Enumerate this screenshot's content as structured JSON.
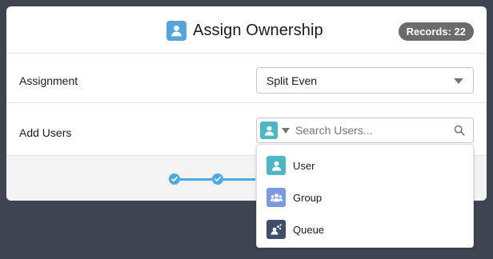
{
  "header": {
    "title": "Assign Ownership",
    "title_icon": "user-icon",
    "badge": "Records: 22"
  },
  "assignment": {
    "label": "Assignment",
    "value": "Split Even"
  },
  "add_users": {
    "label": "Add Users",
    "placeholder": "Search Users...",
    "entity_icon": "user-icon"
  },
  "dropdown": {
    "items": [
      {
        "label": "User",
        "icon": "user-icon",
        "color": "#4fb7c3"
      },
      {
        "label": "Group",
        "icon": "group-icon",
        "color": "#7a9ae3"
      },
      {
        "label": "Queue",
        "icon": "queue-icon",
        "color": "#3d4d6b"
      }
    ]
  },
  "progress": {
    "completed_steps": 2
  },
  "colors": {
    "accent": "#4ba9e6",
    "backdrop": "#3e4551",
    "badge": "#6b6b6b"
  }
}
